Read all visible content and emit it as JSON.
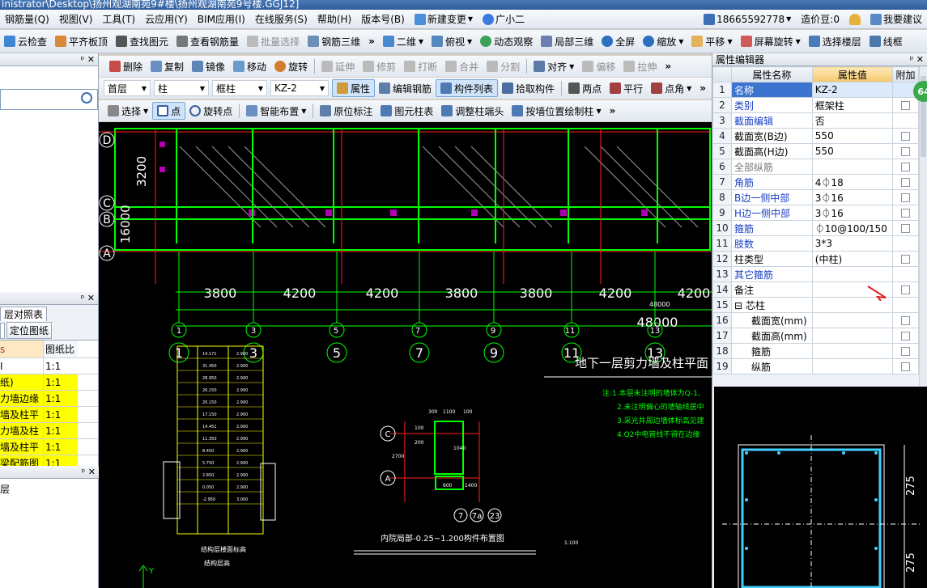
{
  "window_title": "inistrator\\Desktop\\扬州观湖南苑9#楼\\扬州观湖南苑9号楼.GGJ12]",
  "menu": {
    "items": [
      "钢筋量(Q)",
      "视图(V)",
      "工具(T)",
      "云应用(Y)",
      "BIM应用(I)",
      "在线服务(S)",
      "帮助(H)",
      "版本号(B)"
    ],
    "new_change": "新建变更",
    "assistant": "广小二",
    "phone": "18665592778",
    "beans": "造价豆:0",
    "suggest": "我要建议"
  },
  "toolbar1": [
    "云检查",
    "平齐板顶",
    "查找图元",
    "查看钢筋量",
    "批量选择",
    "钢筋三维",
    "二维",
    "俯视",
    "动态观察",
    "局部三维",
    "全屏",
    "缩放",
    "平移",
    "屏幕旋转",
    "选择楼层",
    "线框"
  ],
  "toolbar2": [
    "删除",
    "复制",
    "镜像",
    "移动",
    "旋转",
    "延伸",
    "修剪",
    "打断",
    "合并",
    "分割",
    "对齐",
    "偏移",
    "拉伸"
  ],
  "toolbar3": {
    "floor": "首层",
    "type1": "柱",
    "type2": "框柱",
    "name": "KZ-2",
    "buttons": [
      "属性",
      "编辑钢筋",
      "构件列表",
      "拾取构件",
      "两点",
      "平行",
      "点角"
    ]
  },
  "toolbar4": [
    "选择",
    "点",
    "旋转点",
    "智能布置",
    "原位标注",
    "图元柱表",
    "调整柱端头",
    "按墙位置绘制柱"
  ],
  "left": {
    "panel2_title": "层对照表",
    "locate_btn": "定位图纸",
    "col_header": "图纸比",
    "rows": [
      {
        "name": "I",
        "ratio": "1:1",
        "hl": false
      },
      {
        "name": "纸)",
        "ratio": "1:1",
        "hl": true
      },
      {
        "name": "力墙边缘",
        "ratio": "1:1",
        "hl": true
      },
      {
        "name": "墙及柱平",
        "ratio": "1:1",
        "hl": true
      },
      {
        "name": "力墙及柱",
        "ratio": "1:1",
        "hl": true
      },
      {
        "name": "墙及柱平",
        "ratio": "1:1",
        "hl": true
      },
      {
        "name": "梁配筋图",
        "ratio": "1:1",
        "hl": true
      }
    ],
    "bottom_text": "层"
  },
  "props": {
    "title": "属性编辑器",
    "headers": [
      "属性名称",
      "属性值",
      "附加"
    ],
    "rows": [
      {
        "n": "1",
        "name": "名称",
        "value": "KZ-2",
        "style": "blue",
        "cb": false
      },
      {
        "n": "2",
        "name": "类别",
        "value": "框架柱",
        "style": "blue",
        "cb": true
      },
      {
        "n": "3",
        "name": "截面编辑",
        "value": "否",
        "style": "blue",
        "cb": false
      },
      {
        "n": "4",
        "name": "截面宽(B边)",
        "value": "550",
        "style": "",
        "cb": true
      },
      {
        "n": "5",
        "name": "截面高(H边)",
        "value": "550",
        "style": "",
        "cb": true
      },
      {
        "n": "6",
        "name": "全部纵筋",
        "value": "",
        "style": "gray",
        "cb": true
      },
      {
        "n": "7",
        "name": "角筋",
        "value": "4⏀18",
        "style": "blue",
        "cb": true
      },
      {
        "n": "8",
        "name": "B边一侧中部",
        "value": "3⏀16",
        "style": "blue",
        "cb": true
      },
      {
        "n": "9",
        "name": "H边一侧中部",
        "value": "3⏀16",
        "style": "blue",
        "cb": true
      },
      {
        "n": "10",
        "name": "箍筋",
        "value": "⏀10@100/150",
        "style": "blue",
        "cb": true
      },
      {
        "n": "11",
        "name": "肢数",
        "value": "3*3",
        "style": "blue",
        "cb": false
      },
      {
        "n": "12",
        "name": "柱类型",
        "value": "(中柱)",
        "style": "",
        "cb": true
      },
      {
        "n": "13",
        "name": "其它箍筋",
        "value": "",
        "style": "blue",
        "cb": false
      },
      {
        "n": "14",
        "name": "备注",
        "value": "",
        "style": "",
        "cb": true
      },
      {
        "n": "15",
        "name": "⊟ 芯柱",
        "value": "",
        "style": "",
        "cb": false
      },
      {
        "n": "16",
        "name": "截面宽(mm)",
        "value": "",
        "style": "indent",
        "cb": true
      },
      {
        "n": "17",
        "name": "截面高(mm)",
        "value": "",
        "style": "indent",
        "cb": true
      },
      {
        "n": "18",
        "name": "箍筋",
        "value": "",
        "style": "indent",
        "cb": true
      },
      {
        "n": "19",
        "name": "纵筋",
        "value": "",
        "style": "indent",
        "cb": true
      }
    ],
    "badge": "64",
    "dim_top": "275",
    "dim_bottom": "275"
  },
  "cad": {
    "axis_labels_bottom": [
      "1",
      "3",
      "5",
      "7",
      "9",
      "11",
      "13"
    ],
    "axis_labels_small": [
      "1",
      "3",
      "5",
      "7",
      "9",
      "11",
      "13"
    ],
    "axis_rows": [
      "D",
      "C",
      "B",
      "A"
    ],
    "bay_dims": [
      "3800",
      "4200",
      "4200",
      "3800",
      "3800",
      "4200",
      "4200"
    ],
    "total_dim_small": "48000",
    "total_dim": "48000",
    "drawing_title": "地下一层剪力墙及柱平面",
    "notes": [
      "注:1.本层未注明的墙体为Q-1,",
      "2.未注明偏心的墙轴线居中",
      "3.采光井周边墙体标高见建",
      "4.Q2中电管线不得在边缘"
    ],
    "inner_title": "内院局部-0.25~1.200构件布置图",
    "scale": "1:100",
    "table_title1": "结构层楼面标高",
    "table_title2": "结构层高",
    "levels": [
      "14.171",
      "31.450",
      "28.950",
      "26.150",
      "20.150",
      "17.150",
      "14.451",
      "11.350",
      "8.450",
      "5.750",
      "2.850",
      "0.050",
      "-2.950"
    ],
    "heights": [
      "2.900",
      "2.900",
      "2.900",
      "2.900",
      "2.900",
      "2.900",
      "2.900",
      "2.900",
      "2.900",
      "2.900",
      "2.900",
      "2.900",
      "3.000"
    ],
    "dim_left_big": "3200",
    "dim_left_big2": "16000",
    "detail_nums": [
      "300",
      "1100",
      "100",
      "200",
      "100",
      "1040",
      "2700",
      "600",
      "1400"
    ],
    "detail_axes": [
      "C",
      "A",
      "7",
      "7a",
      "23"
    ]
  }
}
